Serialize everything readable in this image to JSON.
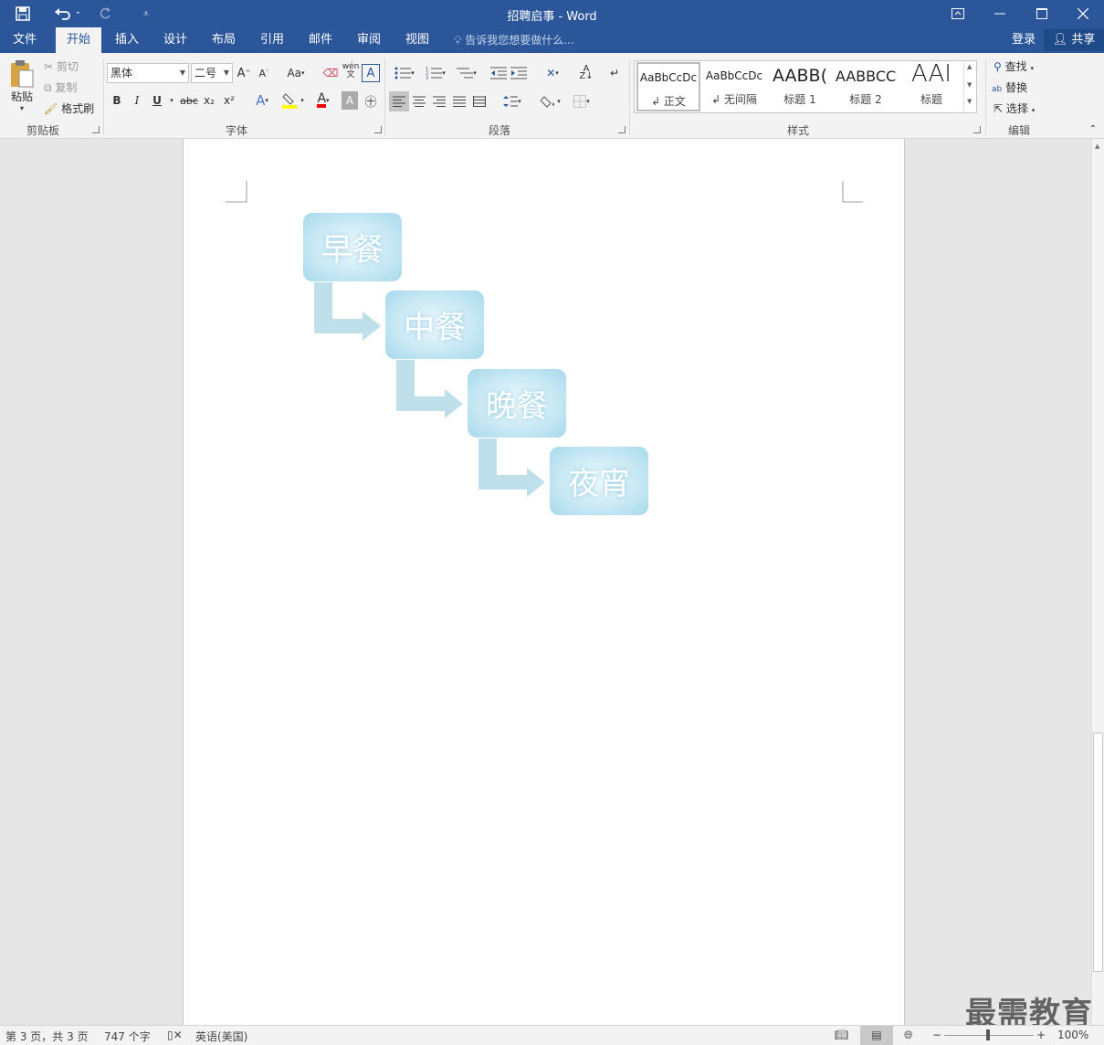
{
  "window": {
    "title": "招聘启事 - Word"
  },
  "quick_access": {
    "save_icon": "save-icon",
    "undo_icon": "undo-icon",
    "redo_icon": "redo-icon",
    "customize_icon": "customize-qat-icon"
  },
  "tabs": [
    {
      "label": "文件",
      "active": false
    },
    {
      "label": "开始",
      "active": true
    },
    {
      "label": "插入",
      "active": false
    },
    {
      "label": "设计",
      "active": false
    },
    {
      "label": "布局",
      "active": false
    },
    {
      "label": "引用",
      "active": false
    },
    {
      "label": "邮件",
      "active": false
    },
    {
      "label": "审阅",
      "active": false
    },
    {
      "label": "视图",
      "active": false
    }
  ],
  "tellme": {
    "placeholder": "告诉我您想要做什么..."
  },
  "account": {
    "login": "登录",
    "share": "共享"
  },
  "ribbon": {
    "clipboard": {
      "label": "剪贴板",
      "paste": "粘贴",
      "cut": "剪切",
      "copy": "复制",
      "format_painter": "格式刷"
    },
    "font": {
      "label": "字体",
      "font_name": "黑体",
      "font_size": "二号",
      "bold": "B",
      "italic": "I",
      "underline": "U",
      "strike": "abc",
      "subscript": "x₂",
      "superscript": "x²",
      "change_case": "Aa",
      "phonetic": "wén"
    },
    "paragraph": {
      "label": "段落"
    },
    "styles": {
      "label": "样式",
      "items": [
        {
          "preview": "AaBbCcDc",
          "name": "↲ 正文"
        },
        {
          "preview": "AaBbCcDc",
          "name": "↲ 无间隔"
        },
        {
          "preview": "AABB(",
          "name": "标题 1"
        },
        {
          "preview": "AABBCC",
          "name": "标题 2"
        },
        {
          "preview": "AAI",
          "name": "标题"
        }
      ]
    },
    "editing": {
      "label": "编辑",
      "find": "查找",
      "replace": "替换",
      "select": "选择"
    }
  },
  "diagram": {
    "steps": [
      "早餐",
      "中餐",
      "晚餐",
      "夜宵"
    ],
    "box_color": "#b5dff0",
    "arrow_color": "#bfe0ea"
  },
  "status": {
    "page": "第 3 页，共 3 页",
    "words": "747 个字",
    "language": "英语(美国)",
    "zoom": "100%"
  },
  "watermark": "最需教育"
}
